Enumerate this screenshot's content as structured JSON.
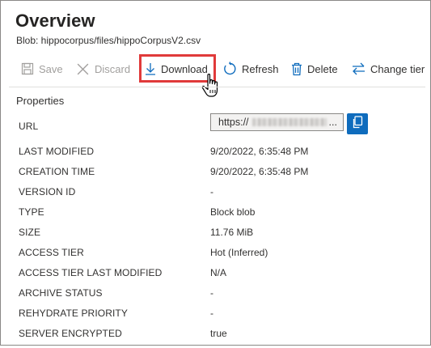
{
  "header": {
    "title": "Overview",
    "subtitle": "Blob: hippocorpus/files/hippoCorpusV2.csv"
  },
  "toolbar": {
    "items": [
      {
        "label": "Save",
        "icon": "save-icon",
        "enabled": false
      },
      {
        "label": "Discard",
        "icon": "close-icon",
        "enabled": false
      },
      {
        "label": "Download",
        "icon": "download-icon",
        "enabled": true,
        "highlighted": true
      },
      {
        "label": "Refresh",
        "icon": "refresh-icon",
        "enabled": true
      },
      {
        "label": "Delete",
        "icon": "trash-icon",
        "enabled": true
      },
      {
        "label": "Change tier",
        "icon": "swap-arrows-icon",
        "enabled": true
      }
    ],
    "highlight_color": "#e03a3a"
  },
  "properties": {
    "section_label": "Properties",
    "url": {
      "key": "URL",
      "value_prefix": "https://",
      "value_suffix": "...",
      "copy_icon": "copy-icon"
    },
    "rows": [
      {
        "key": "LAST MODIFIED",
        "value": "9/20/2022, 6:35:48 PM"
      },
      {
        "key": "CREATION TIME",
        "value": "9/20/2022, 6:35:48 PM"
      },
      {
        "key": "VERSION ID",
        "value": "-"
      },
      {
        "key": "TYPE",
        "value": "Block blob"
      },
      {
        "key": "SIZE",
        "value": "11.76 MiB"
      },
      {
        "key": "ACCESS TIER",
        "value": "Hot (Inferred)"
      },
      {
        "key": "ACCESS TIER LAST MODIFIED",
        "value": "N/A"
      },
      {
        "key": "ARCHIVE STATUS",
        "value": "-"
      },
      {
        "key": "REHYDRATE PRIORITY",
        "value": "-"
      },
      {
        "key": "SERVER ENCRYPTED",
        "value": "true"
      }
    ]
  },
  "colors": {
    "accent": "#0f6cbd",
    "text": "#323130",
    "disabled": "#a19f9d"
  }
}
